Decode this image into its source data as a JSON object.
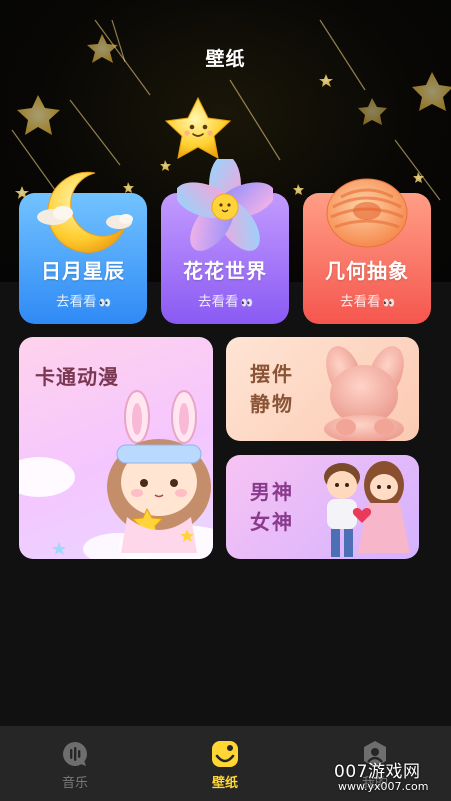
{
  "header": {
    "title": "壁纸"
  },
  "categories": [
    {
      "name": "日月星辰",
      "sub": "去看看",
      "eyes": "👀",
      "icon": "crescent-moon-icon"
    },
    {
      "name": "花花世界",
      "sub": "去看看",
      "eyes": "👀",
      "icon": "flower-icon"
    },
    {
      "name": "几何抽象",
      "sub": "去看看",
      "eyes": "👀",
      "icon": "knot-ring-icon"
    }
  ],
  "tiles": [
    {
      "label": "卡通动漫"
    },
    {
      "label": "摆件静物"
    },
    {
      "label": "男神女神"
    }
  ],
  "tabs": [
    {
      "label": "音乐",
      "icon": "music-chat-icon",
      "active": false
    },
    {
      "label": "壁纸",
      "icon": "wallpaper-face-icon",
      "active": true
    },
    {
      "label": "我的",
      "icon": "profile-icon",
      "active": false
    }
  ],
  "watermark": {
    "text": "007游戏网",
    "sub": "www.yx007.com"
  },
  "colors": {
    "accent_yellow": "#ffd633",
    "card_blue": "#2f8af5",
    "card_purple": "#8a5af3",
    "card_red": "#f5564e",
    "bottom_bar": "#262626"
  }
}
